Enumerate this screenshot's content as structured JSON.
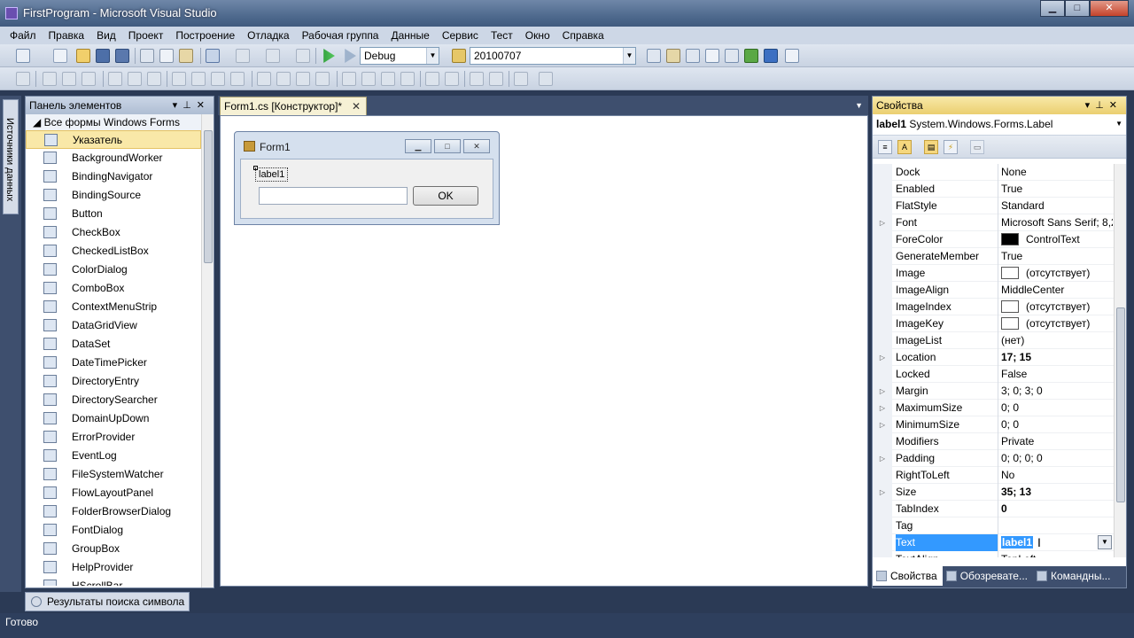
{
  "window": {
    "title": "FirstProgram - Microsoft Visual Studio",
    "controls": [
      "minimize",
      "maximize",
      "close"
    ]
  },
  "menu": [
    "Файл",
    "Правка",
    "Вид",
    "Проект",
    "Построение",
    "Отладка",
    "Рабочая группа",
    "Данные",
    "Сервис",
    "Тест",
    "Окно",
    "Справка"
  ],
  "toolbar": {
    "config_value": "Debug",
    "search_value": "20100707"
  },
  "side_strip": {
    "data_sources_label": "Источники данных"
  },
  "toolbox": {
    "title": "Панель элементов",
    "group": "Все формы Windows Forms",
    "items": [
      {
        "label": "Указатель",
        "icon": "pointer-icon",
        "selected": true
      },
      {
        "label": "BackgroundWorker",
        "icon": "backgroundworker-icon"
      },
      {
        "label": "BindingNavigator",
        "icon": "bindingnavigator-icon"
      },
      {
        "label": "BindingSource",
        "icon": "bindingsource-icon"
      },
      {
        "label": "Button",
        "icon": "button-icon"
      },
      {
        "label": "CheckBox",
        "icon": "checkbox-icon"
      },
      {
        "label": "CheckedListBox",
        "icon": "checkedlistbox-icon"
      },
      {
        "label": "ColorDialog",
        "icon": "colordialog-icon"
      },
      {
        "label": "ComboBox",
        "icon": "combobox-icon"
      },
      {
        "label": "ContextMenuStrip",
        "icon": "contextmenustrip-icon"
      },
      {
        "label": "DataGridView",
        "icon": "datagridview-icon"
      },
      {
        "label": "DataSet",
        "icon": "dataset-icon"
      },
      {
        "label": "DateTimePicker",
        "icon": "datetimepicker-icon"
      },
      {
        "label": "DirectoryEntry",
        "icon": "directoryentry-icon"
      },
      {
        "label": "DirectorySearcher",
        "icon": "directorysearcher-icon"
      },
      {
        "label": "DomainUpDown",
        "icon": "domainupdown-icon"
      },
      {
        "label": "ErrorProvider",
        "icon": "errorprovider-icon"
      },
      {
        "label": "EventLog",
        "icon": "eventlog-icon"
      },
      {
        "label": "FileSystemWatcher",
        "icon": "filesystemwatcher-icon"
      },
      {
        "label": "FlowLayoutPanel",
        "icon": "flowlayoutpanel-icon"
      },
      {
        "label": "FolderBrowserDialog",
        "icon": "folderbrowserdialog-icon"
      },
      {
        "label": "FontDialog",
        "icon": "fontdialog-icon"
      },
      {
        "label": "GroupBox",
        "icon": "groupbox-icon"
      },
      {
        "label": "HelpProvider",
        "icon": "helpprovider-icon"
      },
      {
        "label": "HScrollBar",
        "icon": "hscrollbar-icon"
      }
    ]
  },
  "bottom_tab": {
    "label": "Результаты поиска символа"
  },
  "document": {
    "tab_label": "Form1.cs [Конструктор]*",
    "form": {
      "title": "Form1",
      "label_text": "label1",
      "button_text": "OK"
    }
  },
  "properties": {
    "title": "Свойства",
    "object_name": "label1",
    "object_type": "System.Windows.Forms.Label",
    "rows": [
      {
        "name": "Dock",
        "value": "None"
      },
      {
        "name": "Enabled",
        "value": "True"
      },
      {
        "name": "FlatStyle",
        "value": "Standard"
      },
      {
        "name": "Font",
        "value": "Microsoft Sans Serif; 8,2",
        "expandable": true
      },
      {
        "name": "ForeColor",
        "value": "ControlText",
        "swatch": "#000000"
      },
      {
        "name": "GenerateMember",
        "value": "True"
      },
      {
        "name": "Image",
        "value": "(отсутствует)",
        "swatch": "#ffffff"
      },
      {
        "name": "ImageAlign",
        "value": "MiddleCenter"
      },
      {
        "name": "ImageIndex",
        "value": "(отсутствует)",
        "swatch": "#ffffff"
      },
      {
        "name": "ImageKey",
        "value": "(отсутствует)",
        "swatch": "#ffffff"
      },
      {
        "name": "ImageList",
        "value": "(нет)"
      },
      {
        "name": "Location",
        "value": "17; 15",
        "expandable": true,
        "bold": true
      },
      {
        "name": "Locked",
        "value": "False"
      },
      {
        "name": "Margin",
        "value": "3; 0; 3; 0",
        "expandable": true
      },
      {
        "name": "MaximumSize",
        "value": "0; 0",
        "expandable": true
      },
      {
        "name": "MinimumSize",
        "value": "0; 0",
        "expandable": true
      },
      {
        "name": "Modifiers",
        "value": "Private"
      },
      {
        "name": "Padding",
        "value": "0; 0; 0; 0",
        "expandable": true
      },
      {
        "name": "RightToLeft",
        "value": "No"
      },
      {
        "name": "Size",
        "value": "35; 13",
        "expandable": true,
        "bold": true
      },
      {
        "name": "TabIndex",
        "value": "0",
        "bold": true
      },
      {
        "name": "Tag",
        "value": ""
      },
      {
        "name": "Text",
        "value": "label1",
        "selected": true
      },
      {
        "name": "TextAlign",
        "value": "TopLeft"
      }
    ],
    "tabs": [
      {
        "label": "Свойства",
        "active": true
      },
      {
        "label": "Обозревате..."
      },
      {
        "label": "Командны..."
      }
    ]
  },
  "status": {
    "text": "Готово"
  }
}
